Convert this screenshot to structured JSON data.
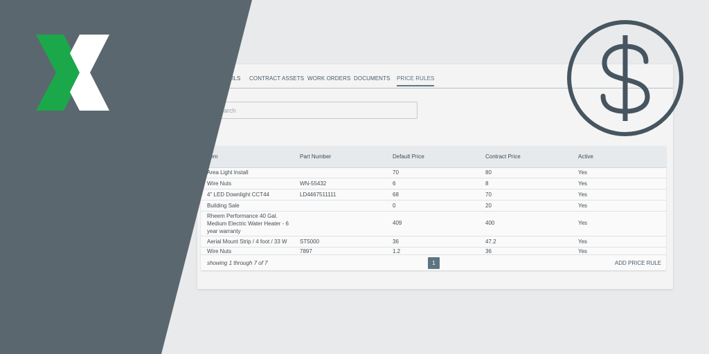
{
  "tabs": [
    {
      "label": "DETAILS"
    },
    {
      "label": "CONTRACT ASSETS"
    },
    {
      "label": "WORK ORDERS"
    },
    {
      "label": "DOCUMENTS"
    },
    {
      "label": "PRICE RULES",
      "active": true
    }
  ],
  "search": {
    "placeholder": "Search",
    "value": ""
  },
  "table": {
    "headers": [
      "Item",
      "Part Number",
      "Default Price",
      "Contract Price",
      "Active"
    ],
    "rows": [
      {
        "item": "Area Light Install",
        "part": "",
        "default": "70",
        "contract": "80",
        "active": "Yes"
      },
      {
        "item": "Wire Nuts",
        "part": "WN-55432",
        "default": "6",
        "contract": "8",
        "active": "Yes"
      },
      {
        "item": "4\" LED Downlight CCT44",
        "part": "LD4467511111",
        "default": "68",
        "contract": "70",
        "active": "Yes"
      },
      {
        "item": "Building Sale",
        "part": "",
        "default": "0",
        "contract": "20",
        "active": "Yes"
      },
      {
        "item": "Rheem Performance 40 Gal. Medium Electric Water Heater - 6 year warranty",
        "part": "",
        "default": "409",
        "contract": "400",
        "active": "Yes"
      },
      {
        "item": "Aerial Mount Strip / 4 foot / 33 W",
        "part": "ST5000",
        "default": "36",
        "contract": "47.2",
        "active": "Yes"
      },
      {
        "item": "Wire Nuts",
        "part": "7897",
        "default": "1.2",
        "contract": "36",
        "active": "Yes"
      }
    ]
  },
  "footer": {
    "showing": "showing 1 through 7 of 7",
    "page": "1",
    "add_label": "ADD PRICE RULE"
  },
  "colors": {
    "dark_panel": "#5b676e",
    "logo_green": "#1aa84a",
    "logo_white": "#ffffff",
    "accent": "#5f7482",
    "dollar_icon": "#46555f"
  }
}
